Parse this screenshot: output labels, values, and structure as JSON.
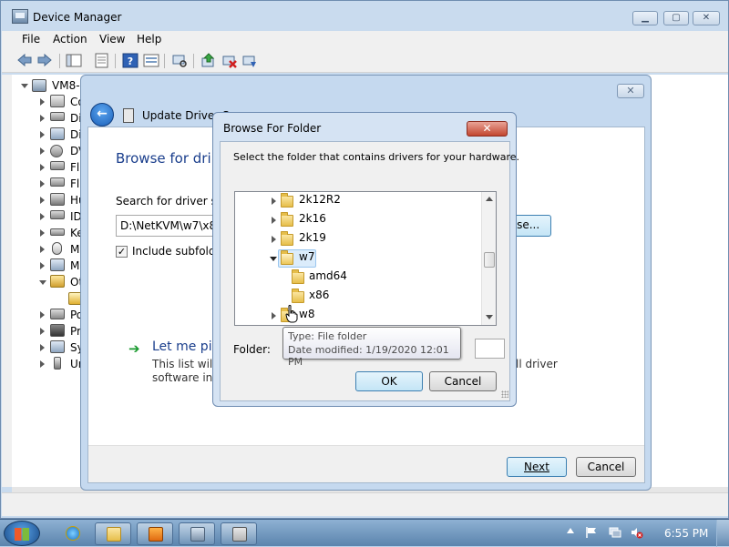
{
  "device_manager": {
    "title": "Device Manager",
    "menu": [
      "File",
      "Action",
      "View",
      "Help"
    ],
    "tree_root": "VM8-",
    "tree_items": [
      "Co",
      "Di",
      "Di",
      "DV",
      "Fl",
      "Fl",
      "Hu",
      "ID",
      "Ke",
      "M",
      "M",
      "Ot",
      "",
      "Po",
      "Pr",
      "Sy",
      "Ur"
    ]
  },
  "update_driver": {
    "title": "Update Driver So",
    "heading": "Browse for dri",
    "search_label": "Search for driver so",
    "path_value": "D:\\NetKVM\\w7\\x8",
    "browse_label": "vse...",
    "include_subfolders": "Include subfold",
    "include_checked": true,
    "let_me_pick": "Let me pi",
    "desc_line1": "This list will",
    "desc_line2": "software in t",
    "desc_right": "ll driver",
    "next_label": "Next",
    "cancel_label": "Cancel"
  },
  "browse_folder": {
    "title": "Browse For Folder",
    "instruction": "Select the folder that contains drivers for your hardware.",
    "folders": [
      {
        "label": "2k12R2",
        "expanded": false,
        "selected": false,
        "level": 0
      },
      {
        "label": "2k16",
        "expanded": false,
        "selected": false,
        "level": 0
      },
      {
        "label": "2k19",
        "expanded": false,
        "selected": false,
        "level": 0
      },
      {
        "label": "w7",
        "expanded": true,
        "selected": true,
        "level": 0
      },
      {
        "label": "amd64",
        "expanded": false,
        "selected": false,
        "level": 1
      },
      {
        "label": "x86",
        "expanded": false,
        "selected": false,
        "level": 1
      },
      {
        "label": "w8",
        "expanded": false,
        "selected": false,
        "level": 0
      }
    ],
    "folder_label": "Folder:",
    "ok_label": "OK",
    "cancel_label": "Cancel"
  },
  "tooltip": {
    "line1": "Type: File folder",
    "line2": "Date modified: 1/19/2020 12:01 PM"
  },
  "taskbar": {
    "clock": "6:55 PM"
  },
  "colors": {
    "accent_blue": "#1a3e8c",
    "selection": "#dbecfb",
    "close_red": "#c24630",
    "taskbar": "#5b84ad"
  }
}
